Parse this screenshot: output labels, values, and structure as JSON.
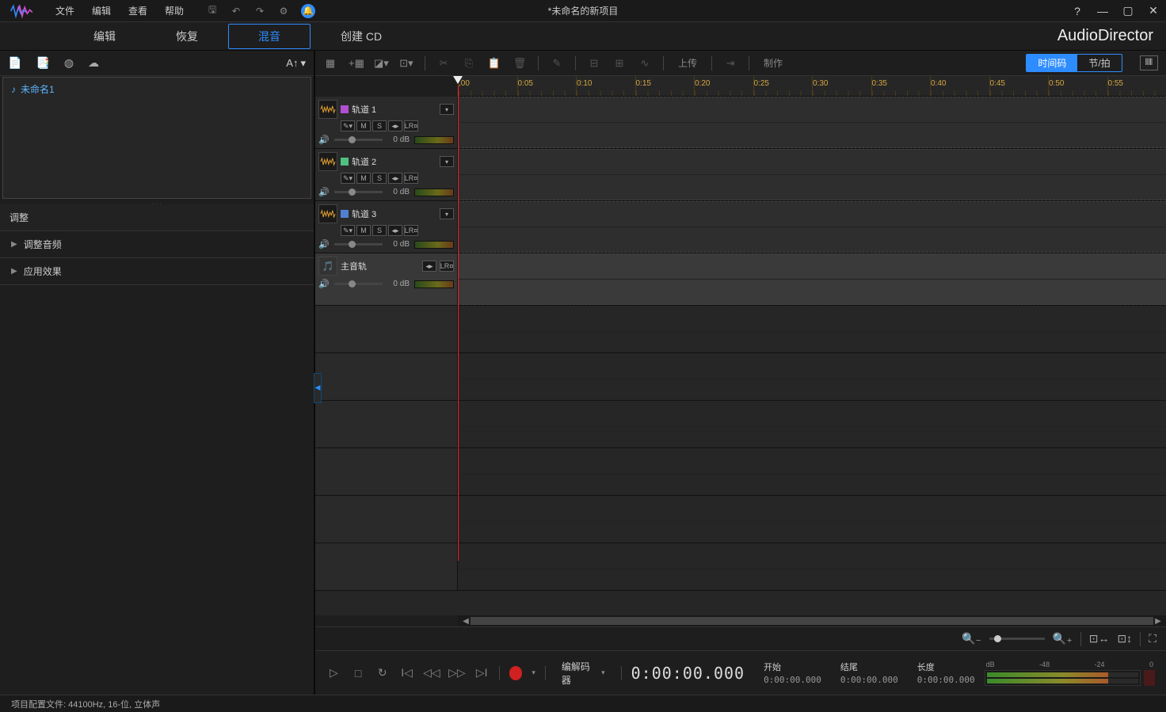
{
  "menubar": {
    "items": [
      "文件",
      "编辑",
      "查看",
      "帮助"
    ],
    "title": "*未命名的新项目"
  },
  "tabs": {
    "items": [
      "编辑",
      "恢复",
      "混音",
      "创建 CD"
    ],
    "active": 2,
    "brand": "AudioDirector"
  },
  "library": {
    "sort_label": "A↑",
    "items": [
      "未命名1"
    ]
  },
  "adjust": {
    "header": "调整",
    "groups": [
      "调整音频",
      "应用效果"
    ]
  },
  "toolbar": {
    "upload": "上传",
    "produce": "制作",
    "view_timecode": "时间码",
    "view_beat": "节/拍"
  },
  "ruler_ticks": [
    ",00",
    "0:05",
    "0:10",
    "0:15",
    "0:20",
    "0:25",
    "0:30",
    "0:35",
    "0:40",
    "0:45",
    "0:50",
    "0:55"
  ],
  "tracks": [
    {
      "name": "轨道 1",
      "color": "#b050d0",
      "db": "0 dB"
    },
    {
      "name": "轨道 2",
      "color": "#50c080",
      "db": "0 dB"
    },
    {
      "name": "轨道 3",
      "color": "#5080d0",
      "db": "0 dB"
    }
  ],
  "master_track": {
    "name": "主音轨",
    "db": "0 dB"
  },
  "track_btns": {
    "m": "M",
    "s": "S",
    "lr": "LR¤"
  },
  "transport": {
    "codec_label": "编解码器",
    "time": "0:00:00.000",
    "start_label": "开始",
    "start_val": "0:00:00.000",
    "end_label": "结尾",
    "end_val": "0:00:00.000",
    "len_label": "长度",
    "len_val": "0:00:00.000"
  },
  "level_scale": [
    "dB",
    "-48",
    "-24",
    "0"
  ],
  "statusbar": "项目配置文件: 44100Hz, 16-位, 立体声"
}
